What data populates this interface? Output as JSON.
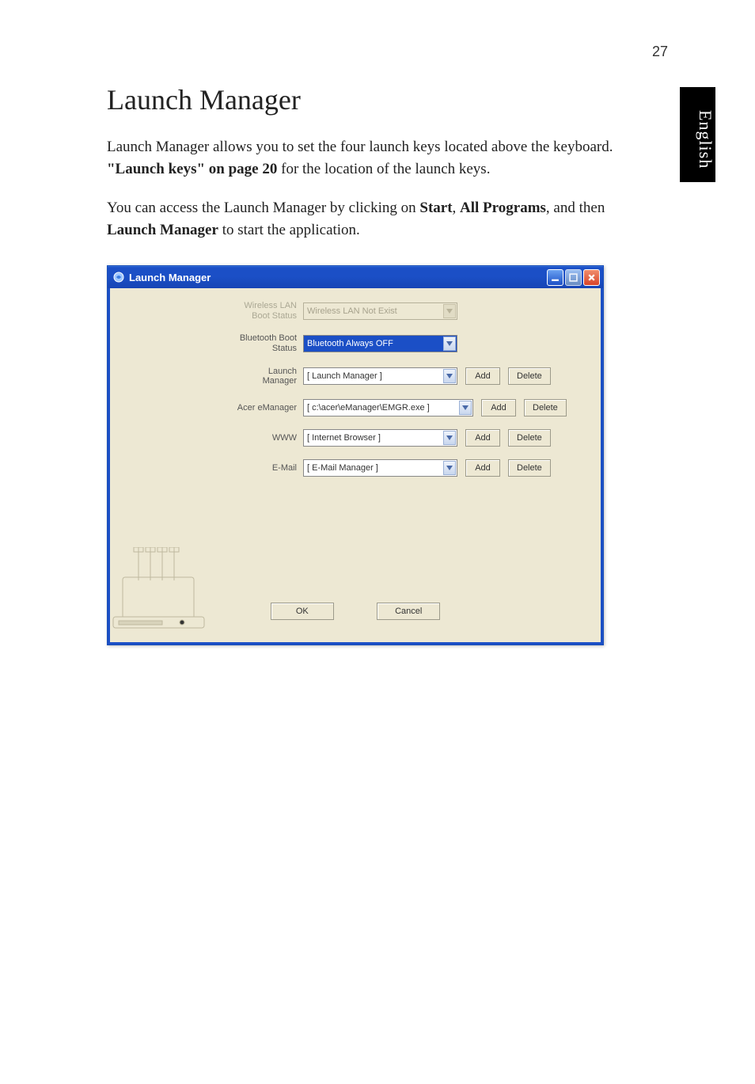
{
  "page_number": "27",
  "side_tab": "English",
  "heading": "Launch Manager",
  "para1_a": "Launch Manager allows you to set the four launch keys located above the keyboard. ",
  "para1_bold": "\"Launch keys\" on page 20",
  "para1_b": " for the location of the launch keys.",
  "para2_a": "You can access the Launch Manager by clicking on ",
  "para2_b": "Start",
  "para2_c": ", ",
  "para2_d": "All Programs",
  "para2_e": ", and then ",
  "para2_f": "Launch Manager",
  "para2_g": " to start the application.",
  "window": {
    "title": "Launch Manager",
    "rows": {
      "wlan_label": "Wireless LAN Boot Status",
      "wlan_value": "Wireless LAN Not Exist",
      "bt_label": "Bluetooth Boot Status",
      "bt_value": "Bluetooth Always OFF",
      "lm_label": "Launch Manager",
      "lm_value": "[  Launch Manager  ]",
      "acer_label": "Acer eManager",
      "acer_value": "[  c:\\acer\\eManager\\EMGR.exe  ]",
      "www_label": "WWW",
      "www_value": "[  Internet Browser  ]",
      "email_label": "E-Mail",
      "email_value": "[  E-Mail Manager  ]"
    },
    "buttons": {
      "add": "Add",
      "delete": "Delete",
      "ok": "OK",
      "cancel": "Cancel"
    }
  }
}
